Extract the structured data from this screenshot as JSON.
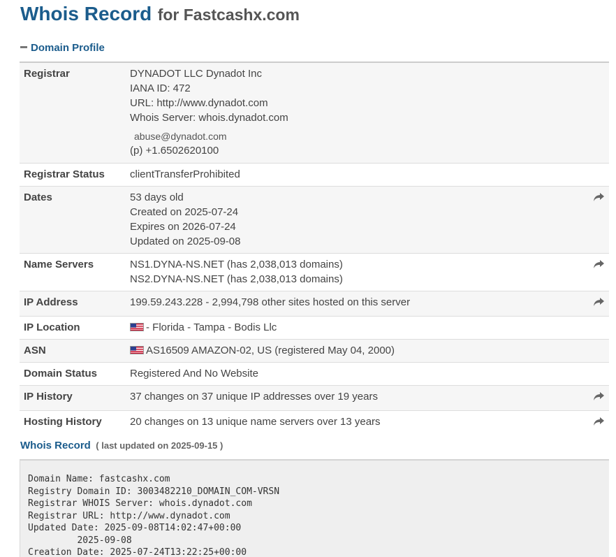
{
  "header": {
    "title": "Whois Record",
    "subtitle": "for Fastcashx.com"
  },
  "profile": {
    "toggle_label": "Domain Profile",
    "registrar": {
      "label": "Registrar",
      "lines": [
        "DYNADOT LLC Dynadot Inc",
        "IANA ID: 472",
        "URL: http://www.dynadot.com",
        "Whois Server: whois.dynadot.com"
      ],
      "email": "abuse@dynadot.com",
      "phone": "(p)  +1.6502620100"
    },
    "registrar_status": {
      "label": "Registrar Status",
      "value": "clientTransferProhibited"
    },
    "dates": {
      "label": "Dates",
      "lines": [
        "53 days old",
        "Created on 2025-07-24",
        "Expires on 2026-07-24",
        "Updated on 2025-09-08"
      ]
    },
    "name_servers": {
      "label": "Name Servers",
      "lines": [
        "NS1.DYNA-NS.NET (has 2,038,013 domains)",
        "NS2.DYNA-NS.NET (has 2,038,013 domains)"
      ]
    },
    "ip_address": {
      "label": "IP Address",
      "value": "199.59.243.228 - 2,994,798 other sites hosted on this server"
    },
    "ip_location": {
      "label": "IP Location",
      "value": "- Florida - Tampa - Bodis Llc",
      "flag_icon": "us-flag-icon"
    },
    "asn": {
      "label": "ASN",
      "value": "AS16509 AMAZON-02, US (registered May 04, 2000)",
      "flag_icon": "us-flag-icon"
    },
    "domain_status": {
      "label": "Domain Status",
      "value": "Registered And No Website"
    },
    "ip_history": {
      "label": "IP History",
      "value": "37 changes on 37 unique IP addresses over 19 years"
    },
    "hosting_history": {
      "label": "Hosting History",
      "value": "20 changes on 13 unique name servers over 13 years"
    }
  },
  "whois_record": {
    "title": "Whois Record",
    "updated": "( last updated on 2025-09-15 )",
    "raw_text": "Domain Name: fastcashx.com\nRegistry Domain ID: 3003482210_DOMAIN_COM-VRSN\nRegistrar WHOIS Server: whois.dynadot.com\nRegistrar URL: http://www.dynadot.com\nUpdated Date: 2025-09-08T14:02:47+00:00\n         2025-09-08\nCreation Date: 2025-07-24T13:22:25+00:00"
  },
  "icons": {
    "share": "share-arrow-icon",
    "collapse": "minus-icon"
  },
  "colors": {
    "accent": "#1b5c8c",
    "row_alt": "#f6f6f6",
    "raw_bg": "#efefef"
  }
}
